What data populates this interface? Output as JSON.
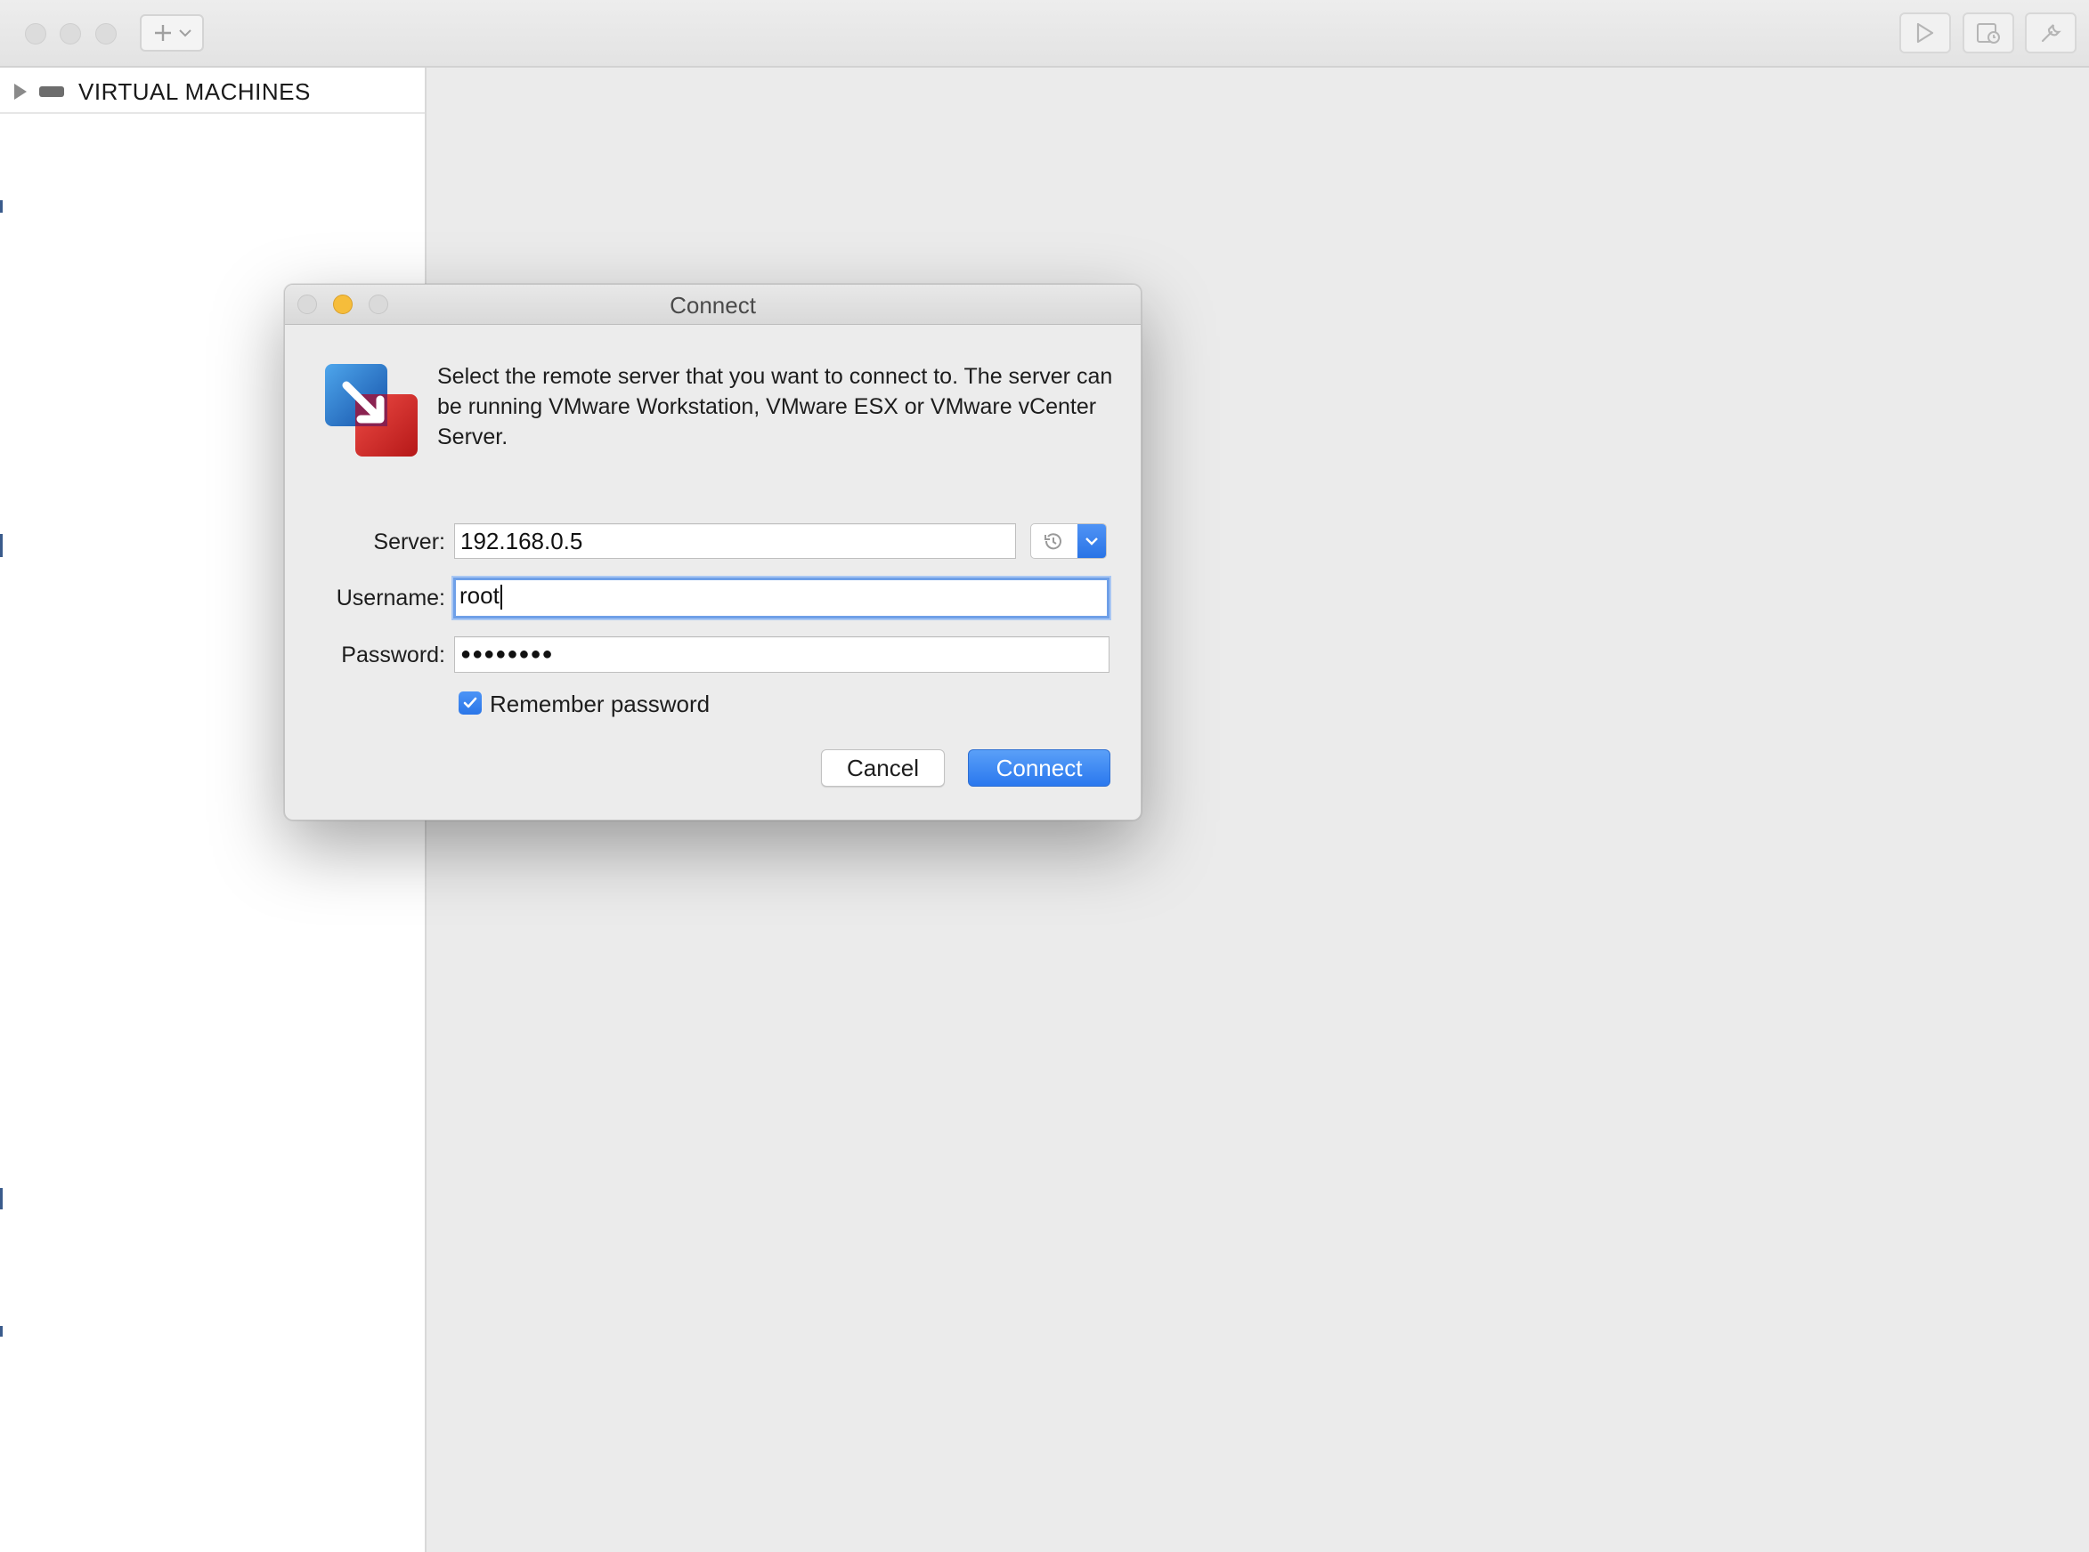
{
  "window": {
    "sidebar": {
      "section_label": "VIRTUAL MACHINES"
    }
  },
  "toolbar": {
    "add_icon": "plus-icon",
    "right_icons": [
      "play-icon",
      "snapshot-icon",
      "wrench-icon"
    ]
  },
  "dialog": {
    "title": "Connect",
    "message": "Select the remote server that you want to connect to. The server can be running VMware Workstation, VMware ESX or VMware vCenter Server.",
    "server_label": "Server:",
    "server_value": "192.168.0.5",
    "username_label": "Username:",
    "username_value": "root",
    "password_label": "Password:",
    "password_mask": "●●●●●●●●",
    "remember_label": "Remember password",
    "remember_checked": true,
    "cancel_label": "Cancel",
    "connect_label": "Connect"
  },
  "colors": {
    "accent": "#2a78ee",
    "focus_ring": "#6fa0e8",
    "minimize": "#f6bd3b"
  }
}
